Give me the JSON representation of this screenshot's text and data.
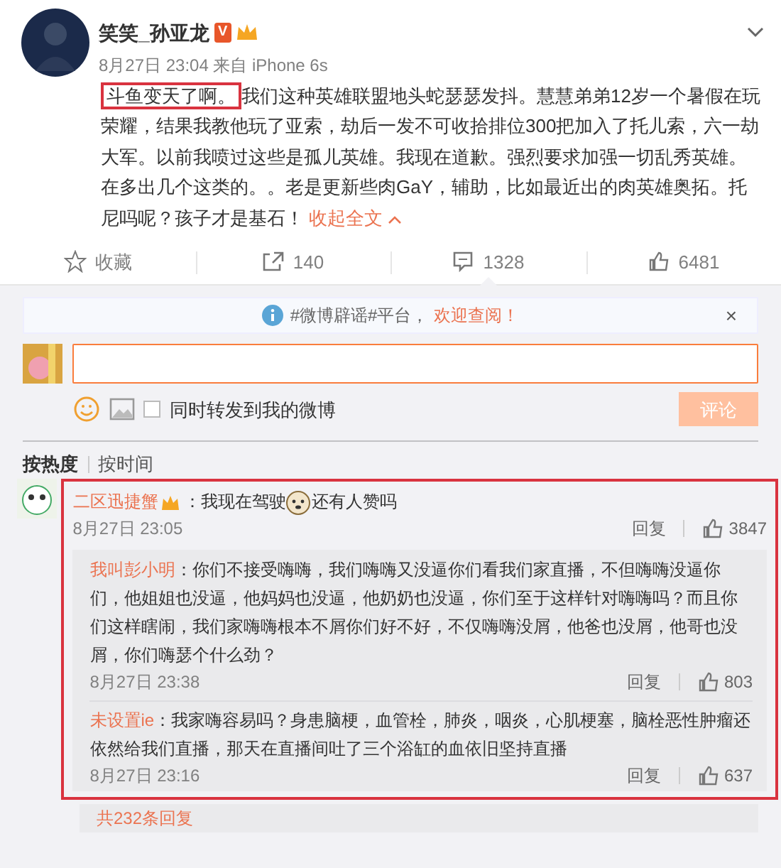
{
  "post": {
    "author": "笑笑_孙亚龙",
    "verified_badge": "V",
    "time": "8月27日 23:04",
    "source": "来自 iPhone 6s",
    "highlight": "斗鱼变天了啊。",
    "highlighted": true,
    "text": "我们这种英雄联盟地头蛇瑟瑟发抖。慧慧弟弟12岁一个暑假在玩荣耀，结果我教他玩了亚索，劫后一发不可收拾排位300把加入了托儿索，六一劫大军。以前我喷过这些是孤儿英雄。我现在道歉。强烈要求加强一切乱秀英雄。在多出几个这类的。。老是更新些肉GaY，辅助，比如最近出的肉英雄奥拓。托尼吗呢？孩子才是基石！",
    "collapse_link": "收起全文"
  },
  "actions": [
    {
      "kind": "favorite",
      "label": "收藏"
    },
    {
      "kind": "repost",
      "label": "140"
    },
    {
      "kind": "comment",
      "label": "1328",
      "selected": true
    },
    {
      "kind": "like",
      "label": "6481"
    }
  ],
  "notice": {
    "text": "#微博辟谣#平台，",
    "link": "欢迎查阅！",
    "close": "×"
  },
  "composer": {
    "repost_label": "同时转发到我的微博",
    "repost_checked": false,
    "submit": "评论",
    "submit_disabled": true
  },
  "sort_tabs": [
    {
      "label": "按热度",
      "selected": true
    },
    {
      "label": "按时间",
      "selected": false
    }
  ],
  "comment": {
    "user": "二区迅捷蟹",
    "highlighted": true,
    "text_before": "：我现在驾驶",
    "text_after": "还有人赞吗",
    "time": "8月27日 23:05",
    "reply": "回复",
    "likes": "3847",
    "replies": [
      {
        "user": "我叫彭小明",
        "text": "：你们不接受嗨嗨，我们嗨嗨又没逼你们看我们家直播，不但嗨嗨没逼你们，他姐姐也没逼，他妈妈也没逼，他奶奶也没逼，你们至于这样针对嗨嗨吗？而且你们这样瞎闹，我们家嗨嗨根本不屑你们好不好，不仅嗨嗨没屑，他爸也没屑，他哥也没屑，你们嗨瑟个什么劲？",
        "time": "8月27日 23:38",
        "reply": "回复",
        "likes": "803"
      },
      {
        "user": "未设置ie",
        "text": "：我家嗨容易吗？身患脑梗，血管栓，肺炎，咽炎，心肌梗塞，脑栓恶性肿瘤还依然给我们直播，那天在直播间吐了三个浴缸的血依旧坚持直播",
        "time": "8月27日 23:16",
        "reply": "回复",
        "likes": "637"
      }
    ],
    "more": "共232条回复"
  }
}
